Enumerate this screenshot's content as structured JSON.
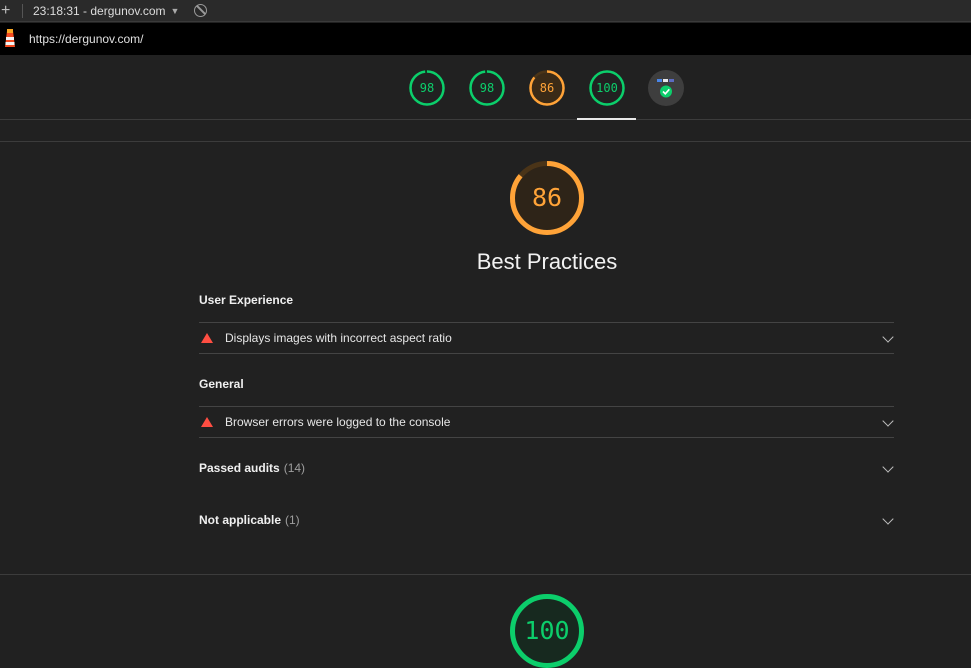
{
  "topbar": {
    "add_label": "+",
    "report_title": "23:18:31 - dergunov.com",
    "caret": "▼"
  },
  "urlbar": {
    "url": "https://dergunov.com/"
  },
  "gauges": [
    {
      "label": "98",
      "score": 98,
      "color": "#0cce6b"
    },
    {
      "label": "98",
      "score": 98,
      "color": "#0cce6b"
    },
    {
      "label": "86",
      "score": 86,
      "color": "#ffa338"
    },
    {
      "label": "100",
      "score": 100,
      "color": "#0cce6b"
    }
  ],
  "category": {
    "score_label": "86",
    "score": 86,
    "title": "Best Practices",
    "color": "#ffa338"
  },
  "groups": [
    {
      "title": "User Experience",
      "audit": "Displays images with incorrect aspect ratio"
    },
    {
      "title": "General",
      "audit": "Browser errors were logged to the console"
    }
  ],
  "passed": {
    "label": "Passed audits",
    "count": "(14)"
  },
  "not_applicable": {
    "label": "Not applicable",
    "count": "(1)"
  },
  "next_category": {
    "score_label": "100",
    "score": 100,
    "color": "#0cce6b"
  }
}
